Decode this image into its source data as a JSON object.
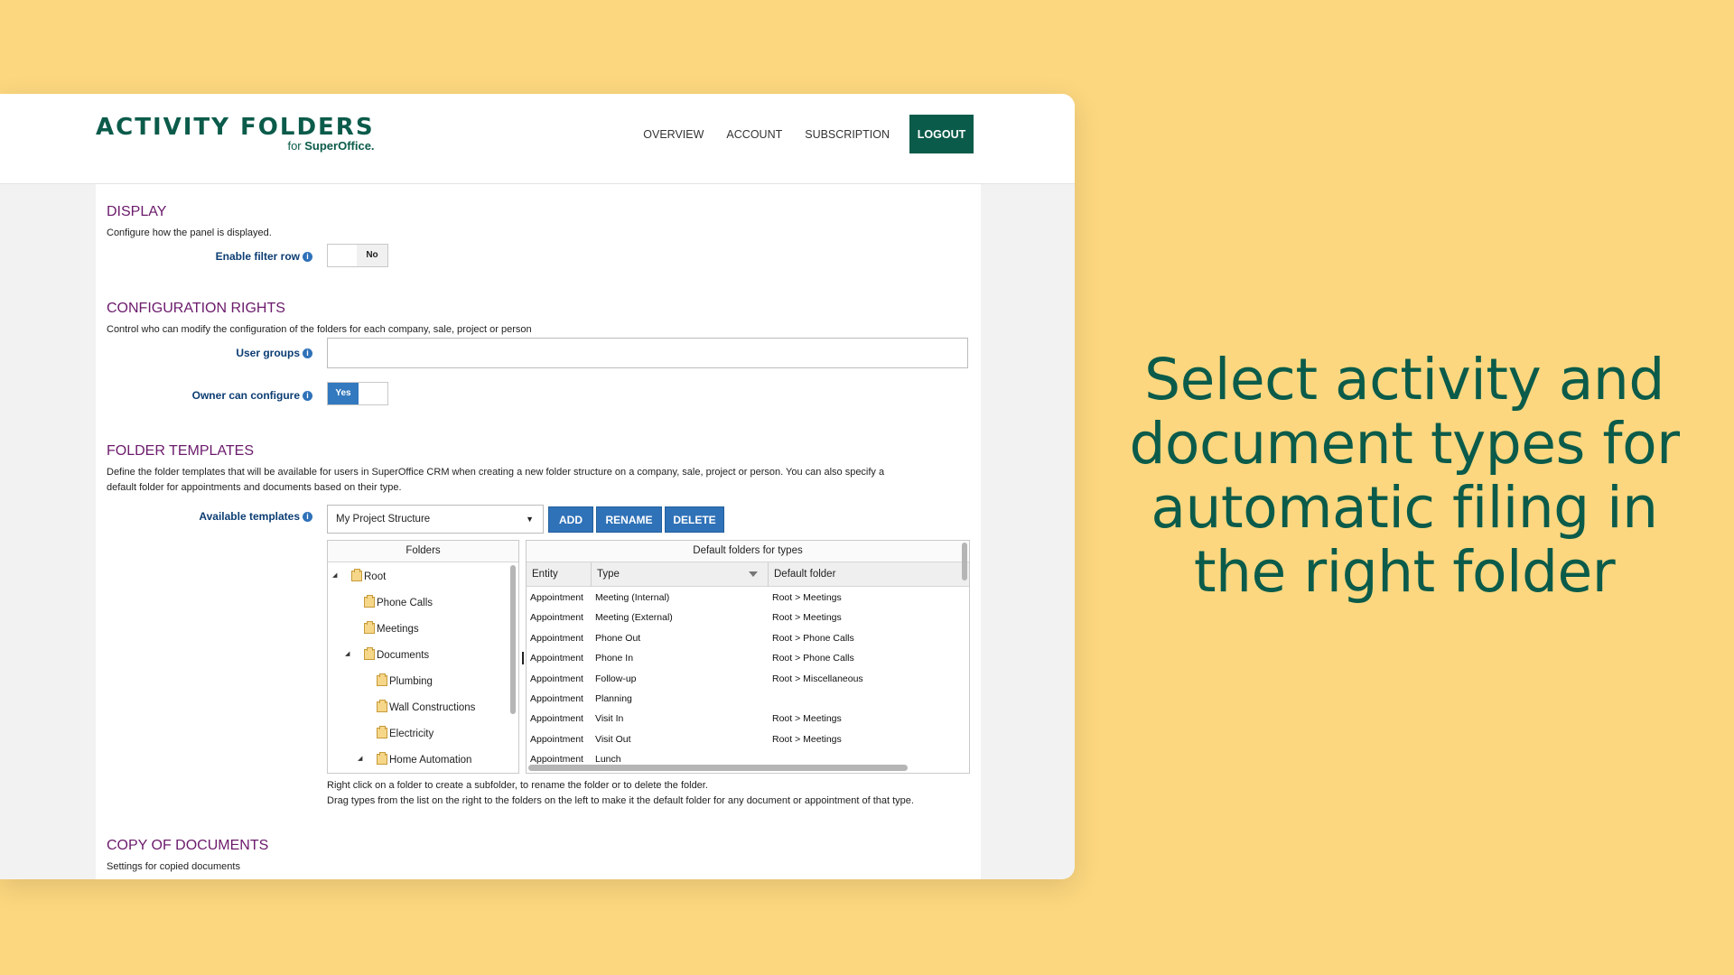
{
  "brand": {
    "title": "ACTIVITY FOLDERS",
    "sub_prefix": "for ",
    "sub_brand": "SuperOffice."
  },
  "nav": {
    "overview": "OVERVIEW",
    "account": "ACCOUNT",
    "subscription": "SUBSCRIPTION",
    "logout": "LOGOUT"
  },
  "display": {
    "title": "DISPLAY",
    "desc": "Configure how the panel is displayed.",
    "filter_label": "Enable filter row",
    "filter_value": "No"
  },
  "config_rights": {
    "title": "CONFIGURATION RIGHTS",
    "desc": "Control who can modify the configuration of the folders for each company, sale, project or person",
    "user_groups_label": "User groups",
    "user_groups_value": "",
    "owner_label": "Owner can configure",
    "owner_value": "Yes"
  },
  "templates": {
    "title": "FOLDER TEMPLATES",
    "desc_line1": "Define the folder templates that will be available for users in SuperOffice CRM when creating a new folder structure on a company, sale, project or person. You can also specify a",
    "desc_line2": "default folder for appointments and documents based on their type.",
    "available_label": "Available templates",
    "selected_template": "My Project Structure",
    "add": "ADD",
    "rename": "RENAME",
    "delete": "DELETE",
    "folders_header": "Folders",
    "folders": [
      {
        "name": "Root"
      },
      {
        "name": "Phone Calls"
      },
      {
        "name": "Meetings"
      },
      {
        "name": "Documents"
      },
      {
        "name": "Plumbing"
      },
      {
        "name": "Wall Constructions"
      },
      {
        "name": "Electricity"
      },
      {
        "name": "Home Automation"
      }
    ],
    "types_header": "Default folders for types",
    "columns": {
      "entity": "Entity",
      "type": "Type",
      "default_folder": "Default folder"
    },
    "rows": [
      {
        "entity": "Appointment",
        "type": "Meeting (Internal)",
        "folder": "Root > Meetings"
      },
      {
        "entity": "Appointment",
        "type": "Meeting (External)",
        "folder": "Root > Meetings"
      },
      {
        "entity": "Appointment",
        "type": "Phone Out",
        "folder": "Root > Phone Calls"
      },
      {
        "entity": "Appointment",
        "type": "Phone In",
        "folder": "Root > Phone Calls"
      },
      {
        "entity": "Appointment",
        "type": "Follow-up",
        "folder": "Root > Miscellaneous"
      },
      {
        "entity": "Appointment",
        "type": "Planning",
        "folder": ""
      },
      {
        "entity": "Appointment",
        "type": "Visit In",
        "folder": "Root > Meetings"
      },
      {
        "entity": "Appointment",
        "type": "Visit Out",
        "folder": "Root > Meetings"
      },
      {
        "entity": "Appointment",
        "type": "Lunch",
        "folder": ""
      }
    ],
    "note_line1": "Right click on a folder to create a subfolder, to rename the folder or to delete the folder.",
    "note_line2": "Drag types from the list on the right to the folders on the left to make it the default folder for any document or appointment of that type."
  },
  "copy_docs": {
    "title": "COPY OF DOCUMENTS",
    "desc": "Settings for copied documents"
  },
  "headline": "Select activity and document types for automatic filing in the right folder",
  "colors": {
    "background": "#fcd77f",
    "brand_green": "#0b5b4a",
    "section_purple": "#6b1a6b",
    "button_blue": "#2f72b8"
  }
}
